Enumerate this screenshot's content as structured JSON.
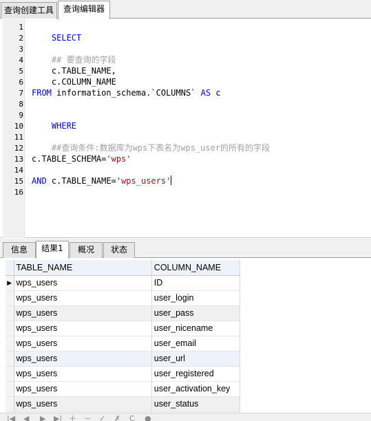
{
  "top_tabs": [
    "查询创建工具",
    "查询编辑器"
  ],
  "editor": {
    "line_numbers": [
      "1",
      "2",
      "3",
      "4",
      "5",
      "6",
      "7",
      "8",
      "9",
      "10",
      "11",
      "12",
      "13",
      "14",
      "15",
      "16"
    ],
    "lines": {
      "l1_kw": "SELECT",
      "l3_comment": "## 要查询的字段",
      "l4": "c.TABLE_NAME,",
      "l5": "c.COLUMN_NAME",
      "l7_kw": "FROM",
      "l7_text": " information_schema.`COLUMNS` ",
      "l7_kw2": "AS",
      "l7_text2": " c",
      "l9_kw": "WHERE",
      "l11_comment": "##查询条件:数据库为wps下表名为wps_user的所有的字段",
      "l13_text": "c.TABLE_SCHEMA=",
      "l13_str": "'wps'",
      "l15_kw": "AND",
      "l15_text": " c.TABLE_NAME=",
      "l15_str": "'wps_users'"
    }
  },
  "bottom_tabs": [
    "信息",
    "结果1",
    "概况",
    "状态"
  ],
  "results": {
    "columns": [
      "TABLE_NAME",
      "COLUMN_NAME"
    ],
    "rows": [
      [
        "wps_users",
        "ID"
      ],
      [
        "wps_users",
        "user_login"
      ],
      [
        "wps_users",
        "user_pass"
      ],
      [
        "wps_users",
        "user_nicename"
      ],
      [
        "wps_users",
        "user_email"
      ],
      [
        "wps_users",
        "user_url"
      ],
      [
        "wps_users",
        "user_registered"
      ],
      [
        "wps_users",
        "user_activation_key"
      ],
      [
        "wps_users",
        "user_status"
      ]
    ],
    "current_row_marker": "▶"
  },
  "toolbar": {
    "icons": [
      "first-icon",
      "prev-icon",
      "next-icon",
      "last-icon",
      "add-icon",
      "delete-icon",
      "apply-icon",
      "cancel-icon",
      "refresh-icon",
      "stop-icon"
    ],
    "glyphs": [
      "|◀",
      "◀",
      "▶",
      "▶|",
      "＋",
      "－",
      "✓",
      "✗",
      "C",
      "●"
    ]
  }
}
